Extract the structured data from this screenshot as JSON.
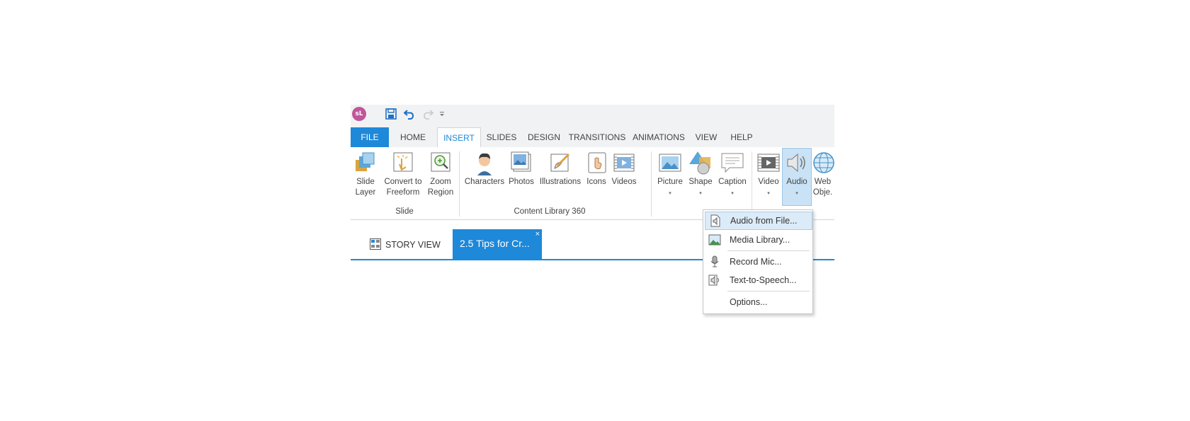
{
  "quick_access": {
    "logo_text": "sL",
    "icons": [
      "save-icon",
      "undo-icon",
      "redo-icon",
      "customize-qat-icon"
    ]
  },
  "ribbon_tabs": [
    "FILE",
    "HOME",
    "INSERT",
    "SLIDES",
    "DESIGN",
    "TRANSITIONS",
    "ANIMATIONS",
    "VIEW",
    "HELP"
  ],
  "active_tab": "INSERT",
  "ribbon": {
    "slide_layer": {
      "line1": "Slide",
      "line2": "Layer"
    },
    "convert_freeform": {
      "line1": "Convert to",
      "line2": "Freeform"
    },
    "zoom_region": {
      "line1": "Zoom",
      "line2": "Region"
    },
    "group_slide": "Slide",
    "characters": "Characters",
    "photos": "Photos",
    "illustrations": "Illustrations",
    "icons": "Icons",
    "videos": "Videos",
    "group_content_library": "Content Library 360",
    "picture": "Picture",
    "shape": "Shape",
    "caption": "Caption",
    "video": "Video",
    "audio": "Audio",
    "web_object": {
      "line1": "Web",
      "line2": "Obje."
    },
    "dropdown_arrow": "▾"
  },
  "doc_tabs": {
    "story_view": "STORY VIEW",
    "current": "2.5 Tips for Cr...",
    "close": "×"
  },
  "audio_menu": {
    "items": [
      {
        "label": "Audio from File...",
        "icon": "audio-file-icon"
      },
      {
        "label": "Media Library...",
        "icon": "media-library-icon"
      },
      {
        "label": "Record Mic...",
        "icon": "microphone-icon"
      },
      {
        "label": "Text-to-Speech...",
        "icon": "text-to-speech-icon"
      },
      {
        "label": "Options...",
        "icon": ""
      }
    ],
    "highlighted": "Audio from File..."
  },
  "colors": {
    "accent": "#1e88d9",
    "ribbon_background": "#f1f2f3",
    "logo": "#c0569a",
    "selected_button": "#c9e2f5"
  }
}
